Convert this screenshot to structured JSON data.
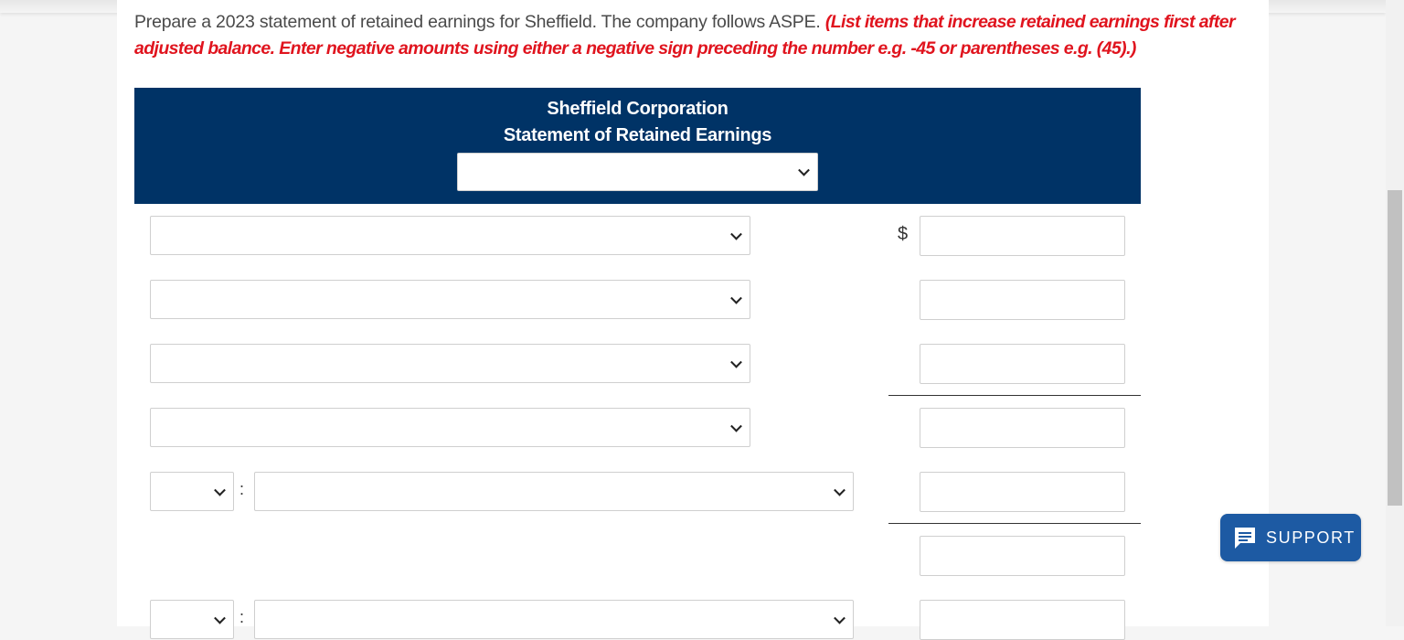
{
  "instructions": {
    "main": "Prepare a 2023 statement of retained earnings for Sheffield. The company follows ASPE.",
    "red": "(List items that increase retained earnings first after adjusted balance. Enter negative amounts using either a negative sign preceding the number e.g. -45 or parentheses e.g. (45).)"
  },
  "statement": {
    "company": "Sheffield Corporation",
    "title": "Statement of Retained Earnings",
    "date_select": ""
  },
  "rows": [
    {
      "label_select": "",
      "currency": "$",
      "amount": ""
    },
    {
      "label_select": "",
      "amount": ""
    },
    {
      "label_select": "",
      "amount": ""
    },
    {
      "label_select": "",
      "amount": ""
    },
    {
      "prefix_select": "",
      "separator": ":",
      "label_select": "",
      "amount": ""
    },
    {
      "amount": ""
    },
    {
      "prefix_select": "",
      "separator": ":",
      "label_select": "",
      "amount": ""
    }
  ],
  "support": {
    "label": "SUPPORT",
    "icon": "chat-icon"
  }
}
